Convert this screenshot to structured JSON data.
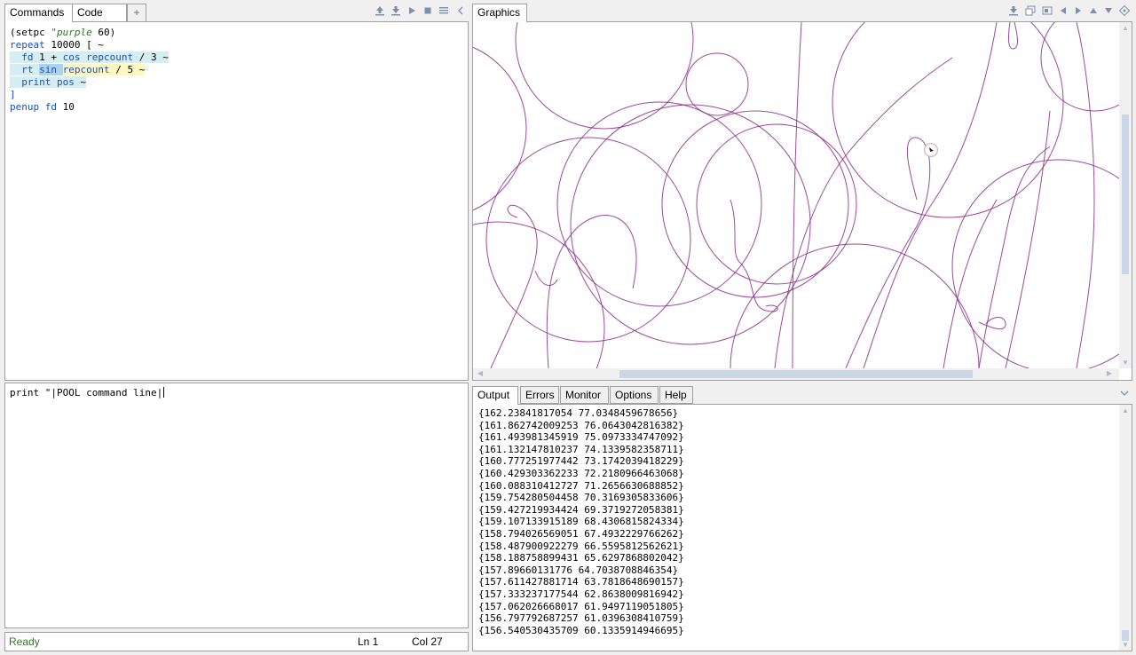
{
  "left_tabs": [
    {
      "label": "Commands",
      "active": true
    },
    {
      "label": "Code",
      "active": false
    },
    {
      "label": "+",
      "active": false
    }
  ],
  "right_tabs": [
    {
      "label": "Graphics",
      "active": true
    }
  ],
  "commands_code": {
    "line1": {
      "a": "(setpc ",
      "b": "\"purple",
      "c": " 60)"
    },
    "line2": {
      "a": "repeat",
      "b": " 10000 [ ~"
    },
    "line3": {
      "a": "  fd",
      "b": " 1 + ",
      "c": "cos",
      "d": " ",
      "e": "repcount",
      "f": " / 3 ~"
    },
    "line4": {
      "a": "  rt",
      "b": " ",
      "c": "sin",
      "d": " ",
      "e": "repcount",
      "f": " / 5 ~"
    },
    "line5": {
      "a": "  print",
      "b": " ",
      "c": "pos",
      "d": " ~"
    },
    "line6": "]",
    "line7": {
      "a": "penup",
      "b": " ",
      "c": "fd",
      "d": " 10"
    }
  },
  "command_line": "print \"|POOL command line|",
  "status": {
    "text": "Ready",
    "line": "Ln 1",
    "col": "Col 27"
  },
  "output_tabs": [
    {
      "label": "Output",
      "active": true
    },
    {
      "label": "Errors",
      "active": false
    },
    {
      "label": "Monitor",
      "active": false
    },
    {
      "label": "Options",
      "active": false
    },
    {
      "label": "Help",
      "active": false
    }
  ],
  "output_lines": [
    "{162.23841817054 77.0348459678656}",
    "{161.862742009253 76.0643042816382}",
    "{161.493981345919 75.0973334747092}",
    "{161.132147810237 74.1339582358711}",
    "{160.777251977442 73.1742039418229}",
    "{160.429303362233 72.2180966463068}",
    "{160.088310412727 71.2656630688852}",
    "{159.754280504458 70.3169305833606}",
    "{159.427219934424 69.3719272058381}",
    "{159.107133915189 68.4306815824334}",
    "{158.794026569051 67.4932229766262}",
    "{158.487900922279 66.5595812562621}",
    "{158.188758899431 65.6297868802042}",
    "{157.89660131776 64.7038708846354}",
    "{157.611427881714 63.7818648690157}",
    "{157.333237177544 62.8638009816942}",
    "{157.062026668017 61.9497119051805}",
    "{156.797792687257 61.0396308410759}",
    "{156.540530435709 60.1335914946695}"
  ],
  "colors": {
    "pen": "#8b2a8b",
    "status_ready": "#2a7a1a"
  },
  "icons": {
    "left_toolbar": [
      "import-icon",
      "export-icon",
      "run-icon",
      "stop-icon",
      "list-icon",
      "collapse-left-icon"
    ],
    "right_toolbar": [
      "save-image-icon",
      "copy-image-icon",
      "fit-icon",
      "pan-left-icon",
      "pan-right-icon",
      "pan-up-icon",
      "pan-down-icon",
      "center-icon"
    ]
  }
}
